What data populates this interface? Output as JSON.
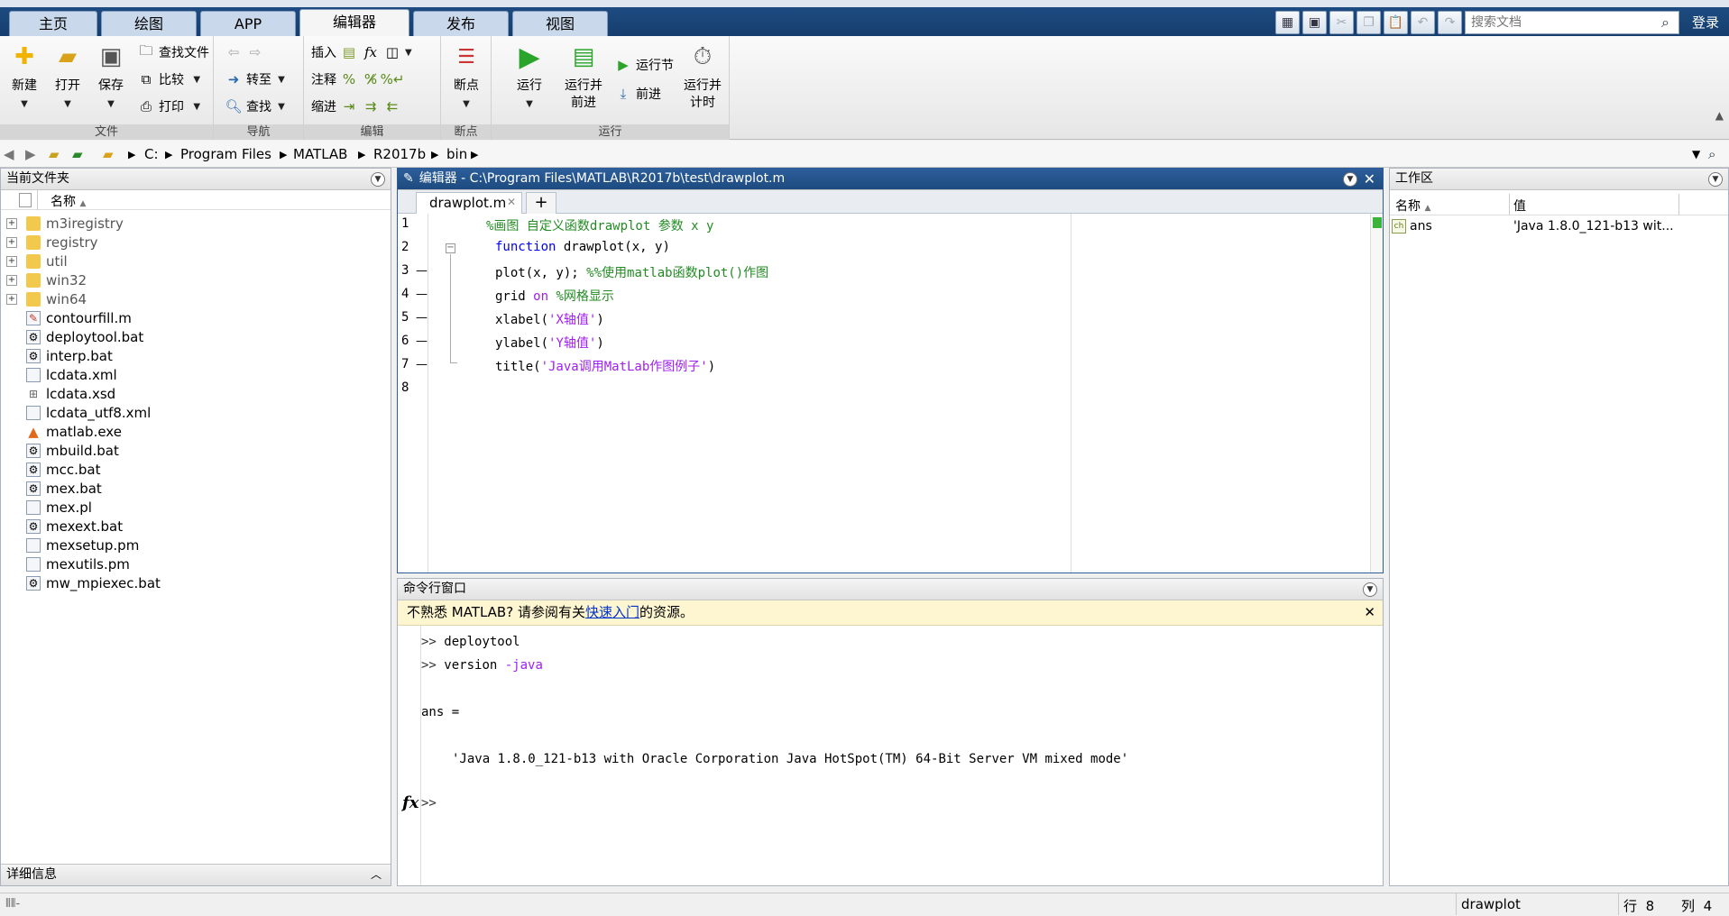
{
  "window": {
    "title": "MATLAB R2017b"
  },
  "tabs": [
    {
      "label": "主页"
    },
    {
      "label": "绘图"
    },
    {
      "label": "APP"
    },
    {
      "label": "编辑器"
    },
    {
      "label": "发布"
    },
    {
      "label": "视图"
    }
  ],
  "search": {
    "placeholder": "搜索文档"
  },
  "login_label": "登录",
  "ribbon": {
    "file": {
      "label": "文件",
      "new": "新建",
      "open": "打开",
      "save": "保存",
      "find_files": "查找文件",
      "compare": "比较",
      "print": "打印"
    },
    "navigate": {
      "label": "导航",
      "goto": "转至",
      "find": "查找"
    },
    "edit": {
      "label": "编辑",
      "insert": "插入",
      "comment": "注释",
      "indent": "缩进"
    },
    "breakpoints": {
      "label": "断点",
      "breakpoints": "断点"
    },
    "run": {
      "label": "运行",
      "run": "运行",
      "run_advance": "运行并\n前进",
      "run_section": "运行节",
      "advance": "前进",
      "run_time": "运行并\n计时"
    }
  },
  "address": {
    "crumbs": [
      "C:",
      "Program Files",
      "MATLAB",
      "R2017b",
      "bin"
    ]
  },
  "current_folder": {
    "title": "当前文件夹",
    "column_name": "名称",
    "folders": [
      "m3iregistry",
      "registry",
      "util",
      "win32",
      "win64"
    ],
    "files": [
      "contourfill.m",
      "deploytool.bat",
      "interp.bat",
      "lcdata.xml",
      "lcdata.xsd",
      "lcdata_utf8.xml",
      "matlab.exe",
      "mbuild.bat",
      "mcc.bat",
      "mex.bat",
      "mex.pl",
      "mexext.bat",
      "mexsetup.pm",
      "mexutils.pm",
      "mw_mpiexec.bat"
    ],
    "details_label": "详细信息"
  },
  "editor": {
    "title": "编辑器 - C:\\Program Files\\MATLAB\\R2017b\\test\\drawplot.m",
    "tab_label": "drawplot.m",
    "lines": {
      "l1": "%画图 自定义函数drawplot 参数 x y",
      "l2_kw": "function",
      "l2_rest": " drawplot(x, y)",
      "l3_code": "plot(x, y); ",
      "l3_comment": "%%使用matlab函数plot()作图",
      "l4_code": "grid ",
      "l4_kw": "on",
      "l4_comment": " %网格显示",
      "l5_code": "xlabel(",
      "l5_str": "'X轴值'",
      "l5_end": ")",
      "l6_code": "ylabel(",
      "l6_str": "'Y轴值'",
      "l6_end": ")",
      "l7_code": "title(",
      "l7_str": "'Java调用MatLab作图例子'",
      "l7_end": ")"
    }
  },
  "command_window": {
    "title": "命令行窗口",
    "notice_prefix": "不熟悉 MATLAB? 请参阅有关",
    "notice_link": "快速入门",
    "notice_suffix": "的资源。",
    "prompt": ">>",
    "cmd1": "deploytool",
    "cmd2_a": "version ",
    "cmd2_b": "-java",
    "ans_label": "ans =",
    "ans_value": "'Java 1.8.0_121-b13 with Oracle Corporation Java HotSpot(TM) 64-Bit Server VM mixed mode'",
    "fx": "fx"
  },
  "workspace": {
    "title": "工作区",
    "col_name": "名称",
    "col_value": "值",
    "var_name": "ans",
    "var_value": "'Java 1.8.0_121-b13 wit..."
  },
  "status": {
    "function": "drawplot",
    "row_label": "行",
    "row": "8",
    "col_label": "列",
    "col": "4"
  }
}
